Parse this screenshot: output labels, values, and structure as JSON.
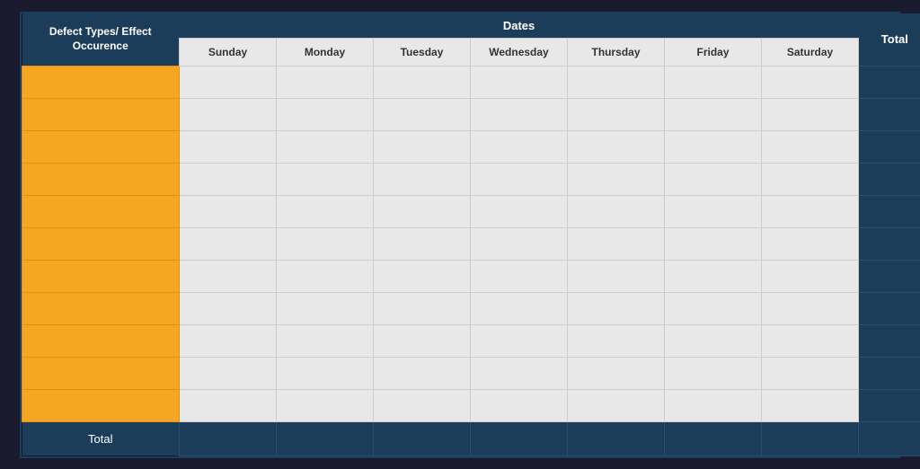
{
  "table": {
    "header": {
      "defect_label": "Defect Types/ Effect Occurence",
      "dates_label": "Dates",
      "total_label": "Total"
    },
    "days": [
      "Sunday",
      "Monday",
      "Tuesday",
      "Wednesday",
      "Thursday",
      "Friday",
      "Saturday"
    ],
    "rows": [
      {
        "defect": "",
        "total": ""
      },
      {
        "defect": "",
        "total": ""
      },
      {
        "defect": "",
        "total": ""
      },
      {
        "defect": "",
        "total": ""
      },
      {
        "defect": "",
        "total": ""
      },
      {
        "defect": "",
        "total": ""
      },
      {
        "defect": "",
        "total": ""
      },
      {
        "defect": "",
        "total": ""
      },
      {
        "defect": "",
        "total": ""
      },
      {
        "defect": "",
        "total": ""
      },
      {
        "defect": "",
        "total": ""
      }
    ],
    "total_row_label": "Total"
  },
  "colors": {
    "header_bg": "#1c3d5a",
    "defect_bg": "#f5a623",
    "data_bg": "#e8e8e8",
    "total_col_bg": "#1c3d5a"
  }
}
